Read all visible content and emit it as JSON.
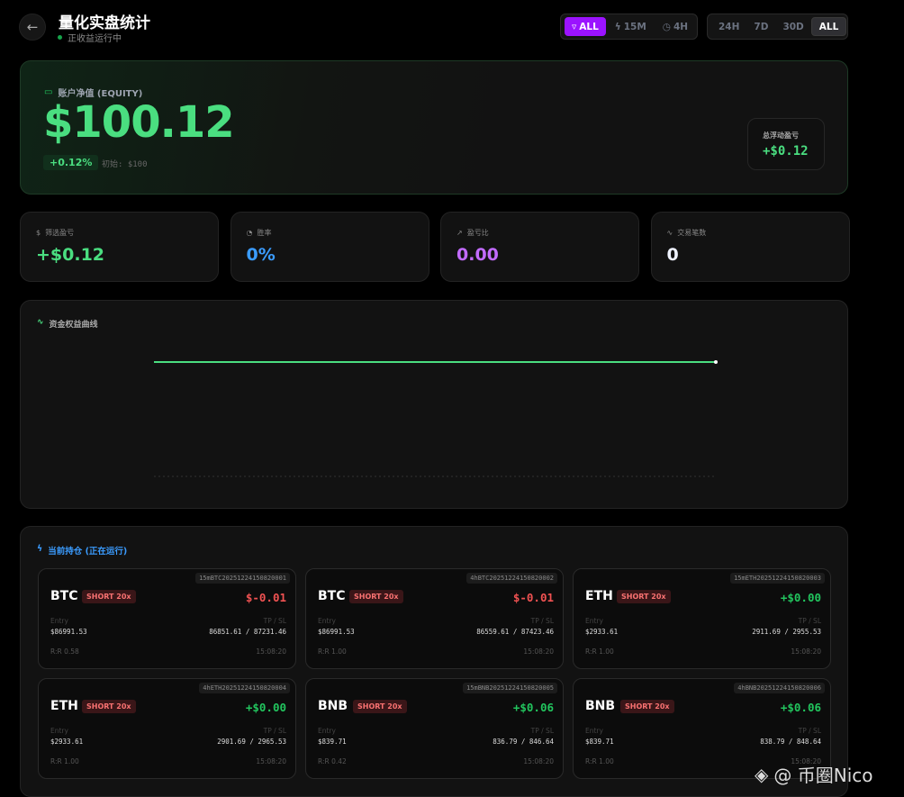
{
  "header": {
    "title": "量化实盘统计",
    "status": "正收益运行中"
  },
  "filters": {
    "strategy": [
      {
        "label": "ALL",
        "icon": "filter-icon",
        "active": true
      },
      {
        "label": "15M",
        "icon": "bolt-icon"
      },
      {
        "label": "4H",
        "icon": "clock-icon"
      }
    ],
    "range": [
      {
        "label": "24H"
      },
      {
        "label": "7D"
      },
      {
        "label": "30D"
      },
      {
        "label": "ALL",
        "active": true
      }
    ]
  },
  "equity": {
    "label": "账户净值 (EQUITY)",
    "value": "$100.12",
    "pct": "+0.12%",
    "initial": "初始: $100",
    "float_label": "总浮动盈亏",
    "float_value": "+$0.12"
  },
  "stats": [
    {
      "label": "筛选盈亏",
      "value": "+$0.12",
      "icon": "dollar-icon",
      "color": "#4ade80"
    },
    {
      "label": "胜率",
      "value": "0%",
      "icon": "pie-icon",
      "color": "#3b9cff"
    },
    {
      "label": "盈亏比",
      "value": "0.00",
      "icon": "trend-icon",
      "color": "#c26bff"
    },
    {
      "label": "交易笔数",
      "value": "0",
      "icon": "activity-icon",
      "color": "#eef2ff"
    }
  ],
  "chart_data": {
    "type": "line",
    "title": "资金权益曲线",
    "series": [
      {
        "name": "equity",
        "values": [
          100.12,
          100.12
        ]
      }
    ],
    "color": "#4ade80"
  },
  "positions": {
    "title": "当前持仓 (正在运行)",
    "entry_label": "Entry",
    "tpsl_label": "TP / SL",
    "items": [
      {
        "id": "15mBTC20251224150820001",
        "symbol": "BTC",
        "side": "SHORT 20x",
        "pnl": "$-0.01",
        "entry": "$86991.53",
        "tpsl": "86851.61 / 87231.46",
        "rr": "R:R 0.58",
        "time": "15:08:20",
        "positive": false
      },
      {
        "id": "4hBTC20251224150820002",
        "symbol": "BTC",
        "side": "SHORT 20x",
        "pnl": "$-0.01",
        "entry": "$86991.53",
        "tpsl": "86559.61 / 87423.46",
        "rr": "R:R 1.00",
        "time": "15:08:20",
        "positive": false
      },
      {
        "id": "15mETH20251224150820003",
        "symbol": "ETH",
        "side": "SHORT 20x",
        "pnl": "+$0.00",
        "entry": "$2933.61",
        "tpsl": "2911.69 / 2955.53",
        "rr": "R:R 1.00",
        "time": "15:08:20",
        "positive": true
      },
      {
        "id": "4hETH20251224150820004",
        "symbol": "ETH",
        "side": "SHORT 20x",
        "pnl": "+$0.00",
        "entry": "$2933.61",
        "tpsl": "2901.69 / 2965.53",
        "rr": "R:R 1.00",
        "time": "15:08:20",
        "positive": true
      },
      {
        "id": "15mBNB20251224150820005",
        "symbol": "BNB",
        "side": "SHORT 20x",
        "pnl": "+$0.06",
        "entry": "$839.71",
        "tpsl": "836.79 / 846.64",
        "rr": "R:R 0.42",
        "time": "15:08:20",
        "positive": true
      },
      {
        "id": "4hBNB20251224150820006",
        "symbol": "BNB",
        "side": "SHORT 20x",
        "pnl": "+$0.06",
        "entry": "$839.71",
        "tpsl": "838.79 / 848.64",
        "rr": "R:R 1.00",
        "time": "15:08:20",
        "positive": true
      }
    ]
  },
  "watermark": "@ 币圈Nico"
}
